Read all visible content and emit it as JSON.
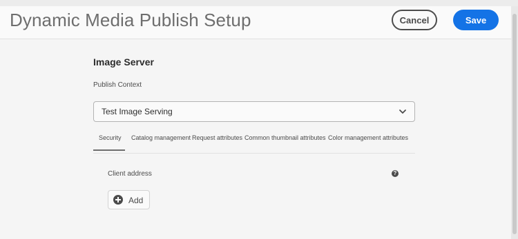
{
  "header": {
    "title": "Dynamic Media Publish Setup",
    "cancel_label": "Cancel",
    "save_label": "Save",
    "save_color": "#1473e6"
  },
  "section": {
    "title": "Image Server",
    "publish_context_label": "Publish Context",
    "publish_context_value": "Test Image Serving",
    "dropdown_icon": "chevron-down-icon"
  },
  "tabs": [
    {
      "label": "Security",
      "selected": true
    },
    {
      "label": "Catalog management",
      "selected": false
    },
    {
      "label": "Request attributes",
      "selected": false
    },
    {
      "label": "Common thumbnail attributes",
      "selected": false
    },
    {
      "label": "Color management attributes",
      "selected": false
    }
  ],
  "security": {
    "client_address_label": "Client address",
    "help_icon": "help-icon",
    "help_symbol": "?",
    "add_label": "Add",
    "add_icon": "add-circle-icon"
  }
}
